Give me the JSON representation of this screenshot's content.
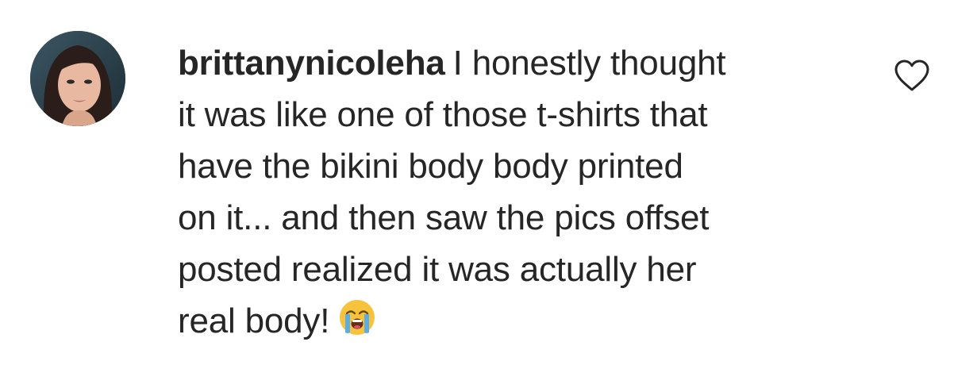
{
  "comment": {
    "username": "brittanynicoleha",
    "text_lines": [
      "I honestly thought",
      "it was like one of those t-shirts that",
      "have the bikini body body printed",
      "on it... and then saw the pics offset",
      "posted realized it was actually her",
      "real body!"
    ],
    "emoji": "loudly-crying-face",
    "like_icon": "heart-outline-icon"
  },
  "colors": {
    "text": "#262626",
    "background": "#ffffff",
    "emoji_face": "#f7c33c",
    "emoji_tears": "#5aaee8"
  }
}
